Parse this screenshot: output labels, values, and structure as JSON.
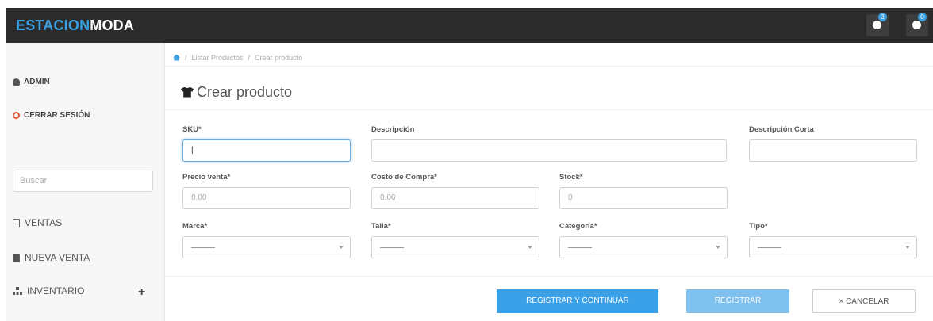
{
  "brand": {
    "part1": "ESTACION",
    "part2": "MODA"
  },
  "topbar": {
    "icons": [
      "settings-icon",
      "bell-icon"
    ],
    "badge1": "3",
    "badge2": "0"
  },
  "sidebar": {
    "admin": "ADMIN",
    "logout": "CERRAR SESIÓN",
    "search_placeholder": "Buscar",
    "nav": [
      "VENTAS",
      "NUEVA VENTA",
      "INVENTARIO"
    ]
  },
  "breadcrumb": [
    "Listar Productos",
    "Crear producto"
  ],
  "page": {
    "title": "Crear producto"
  },
  "form": {
    "sku": {
      "label": "SKU*",
      "value": "|"
    },
    "descripcion": {
      "label": "Descripción",
      "value": ""
    },
    "descripcion_corta": {
      "label": "Descripción Corta",
      "value": ""
    },
    "precio_venta": {
      "label": "Precio venta*",
      "placeholder": "0.00"
    },
    "costo_compra": {
      "label": "Costo de Compra*",
      "placeholder": "0.00"
    },
    "stock": {
      "label": "Stock*",
      "placeholder": "0"
    },
    "marca": {
      "label": "Marca*",
      "selected": "---------"
    },
    "talla": {
      "label": "Talla*",
      "selected": "---------"
    },
    "categoria": {
      "label": "Categoría*",
      "selected": "---------"
    },
    "tipo": {
      "label": "Tipo*",
      "selected": "---------"
    }
  },
  "actions": {
    "register_continue": "REGISTRAR Y CONTINUAR",
    "register": "REGISTRAR",
    "cancel": "× CANCELAR"
  },
  "colors": {
    "topbar": "#2b2b2b",
    "accent": "#3aa0e8"
  }
}
